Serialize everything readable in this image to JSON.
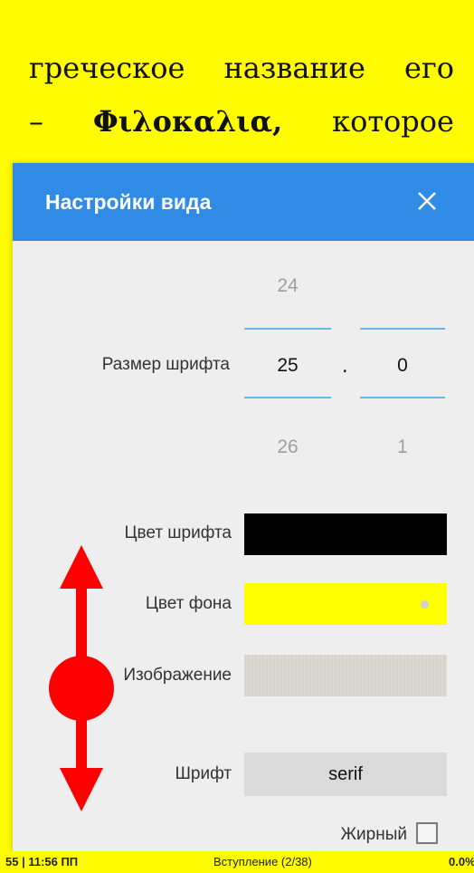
{
  "reader": {
    "line1": [
      "греческое",
      "название",
      "его"
    ],
    "line2": [
      "–",
      "Φιλοκαλια,",
      "которое"
    ]
  },
  "dialog": {
    "title": "Настройки вида",
    "font_size": {
      "label": "Размер шрифта",
      "int_prev": "24",
      "int_current": "25",
      "int_next": "26",
      "separator": ".",
      "frac_current": "0",
      "frac_next": "1"
    },
    "font_color": {
      "label": "Цвет шрифта",
      "value": "#000000"
    },
    "bg_color": {
      "label": "Цвет фона",
      "value": "#ffff00"
    },
    "image": {
      "label": "Изображение"
    },
    "font": {
      "label": "Шрифт",
      "value": "serif"
    },
    "bold": {
      "label": "Жирный",
      "checked": false
    }
  },
  "statusbar": {
    "left": "55 | 11:56 ПП",
    "center": "Вступление (2/38)",
    "right": "0.0%"
  },
  "colors": {
    "accent": "#2f8be6",
    "page_bg": "#fffb00",
    "gesture": "#ff0000"
  }
}
